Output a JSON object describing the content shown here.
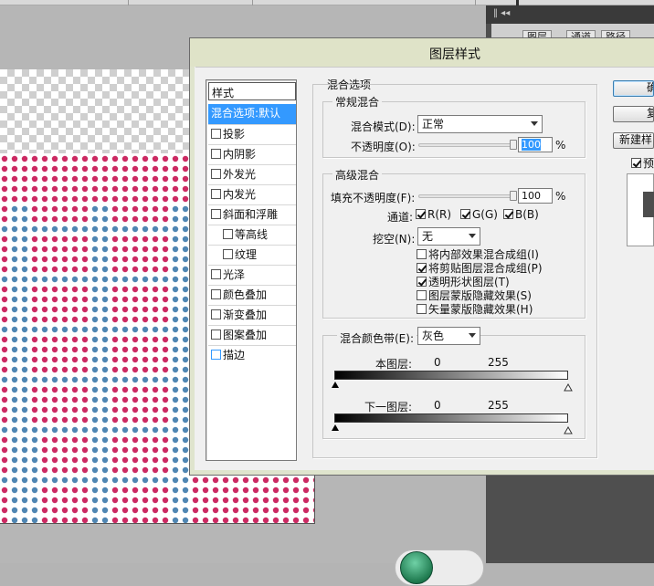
{
  "panel": {
    "tabs": [
      "图层",
      "通道",
      "路径"
    ]
  },
  "dialog": {
    "title": "图层样式",
    "style_list": {
      "header": "样式",
      "items": [
        {
          "label": "混合选项:默认",
          "checkbox": false,
          "selected": true,
          "sub": false
        },
        {
          "label": "投影",
          "checkbox": true,
          "checked": false,
          "sub": false
        },
        {
          "label": "内阴影",
          "checkbox": true,
          "checked": false,
          "sub": false
        },
        {
          "label": "外发光",
          "checkbox": true,
          "checked": false,
          "sub": false
        },
        {
          "label": "内发光",
          "checkbox": true,
          "checked": false,
          "sub": false
        },
        {
          "label": "斜面和浮雕",
          "checkbox": true,
          "checked": false,
          "sub": false
        },
        {
          "label": "等高线",
          "checkbox": true,
          "checked": false,
          "sub": true
        },
        {
          "label": "纹理",
          "checkbox": true,
          "checked": false,
          "sub": true
        },
        {
          "label": "光泽",
          "checkbox": true,
          "checked": false,
          "sub": false
        },
        {
          "label": "颜色叠加",
          "checkbox": true,
          "checked": false,
          "sub": false
        },
        {
          "label": "渐变叠加",
          "checkbox": true,
          "checked": false,
          "sub": false
        },
        {
          "label": "图案叠加",
          "checkbox": true,
          "checked": false,
          "sub": false
        },
        {
          "label": "描边",
          "checkbox": true,
          "checked": false,
          "sub": false,
          "blue": true
        }
      ]
    },
    "blend_options": {
      "section_title": "混合选项",
      "general": {
        "title": "常规混合",
        "blend_mode_label": "混合模式(D):",
        "blend_mode_value": "正常",
        "opacity_label": "不透明度(O):",
        "opacity_value": "100",
        "opacity_unit": "%",
        "opacity_level": 1.0
      },
      "advanced": {
        "title": "高级混合",
        "fill_opacity_label": "填充不透明度(F):",
        "fill_opacity_value": "100",
        "fill_opacity_unit": "%",
        "fill_opacity_level": 1.0,
        "channels_label": "通道:",
        "channels": [
          {
            "label": "R(R)",
            "checked": true
          },
          {
            "label": "G(G)",
            "checked": true
          },
          {
            "label": "B(B)",
            "checked": true
          }
        ],
        "knockout_label": "挖空(N):",
        "knockout_value": "无",
        "options": [
          {
            "label": "将内部效果混合成组(I)",
            "checked": false
          },
          {
            "label": "将剪贴图层混合成组(P)",
            "checked": true
          },
          {
            "label": "透明形状图层(T)",
            "checked": true
          },
          {
            "label": "图层蒙版隐藏效果(S)",
            "checked": false
          },
          {
            "label": "矢量蒙版隐藏效果(H)",
            "checked": false
          }
        ]
      },
      "blend_if": {
        "label": "混合颜色带(E):",
        "value": "灰色",
        "this_layer_label": "本图层:",
        "this_layer_min": "0",
        "this_layer_max": "255",
        "underlying_label": "下一图层:",
        "underlying_min": "0",
        "underlying_max": "255"
      }
    },
    "buttons": {
      "ok": "确",
      "reset": "复",
      "new_style": "新建样",
      "preview": "预"
    },
    "preview_checked": true
  },
  "colors": {
    "dot_pink": "#cc2a63",
    "dot_blue": "#4f86b3",
    "selection": "#3399ff",
    "title_bar": "#dfe3c8"
  }
}
